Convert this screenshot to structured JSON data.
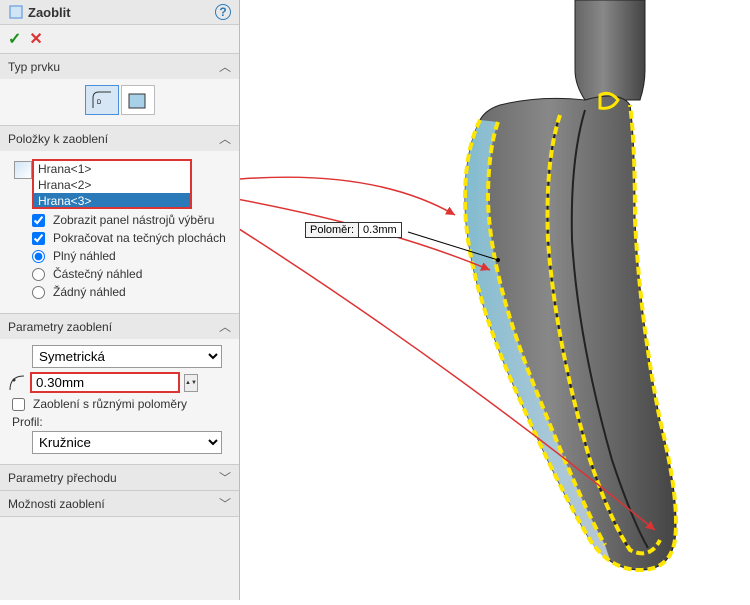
{
  "header": {
    "title": "Zaoblit"
  },
  "typePrvku": {
    "label": "Typ prvku"
  },
  "polozky": {
    "label": "Položky k zaoblení",
    "edges": [
      "Hrana<1>",
      "Hrana<2>",
      "Hrana<3>"
    ],
    "showToolbar": "Zobrazit panel nástrojů výběru",
    "tangent": "Pokračovat na tečných plochách",
    "previewFull": "Plný náhled",
    "previewPartial": "Částečný náhled",
    "previewNone": "Žádný náhled"
  },
  "params": {
    "label": "Parametry zaoblení",
    "symmetry": "Symetrická",
    "radius": "0.30mm",
    "multi": "Zaoblení s různými poloměry",
    "profileLabel": "Profil:",
    "profile": "Kružnice"
  },
  "prechod": {
    "label": "Parametry přechodu"
  },
  "moznosti": {
    "label": "Možnosti zaoblení"
  },
  "callout": {
    "label": "Poloměr:",
    "value": "0.3mm"
  }
}
